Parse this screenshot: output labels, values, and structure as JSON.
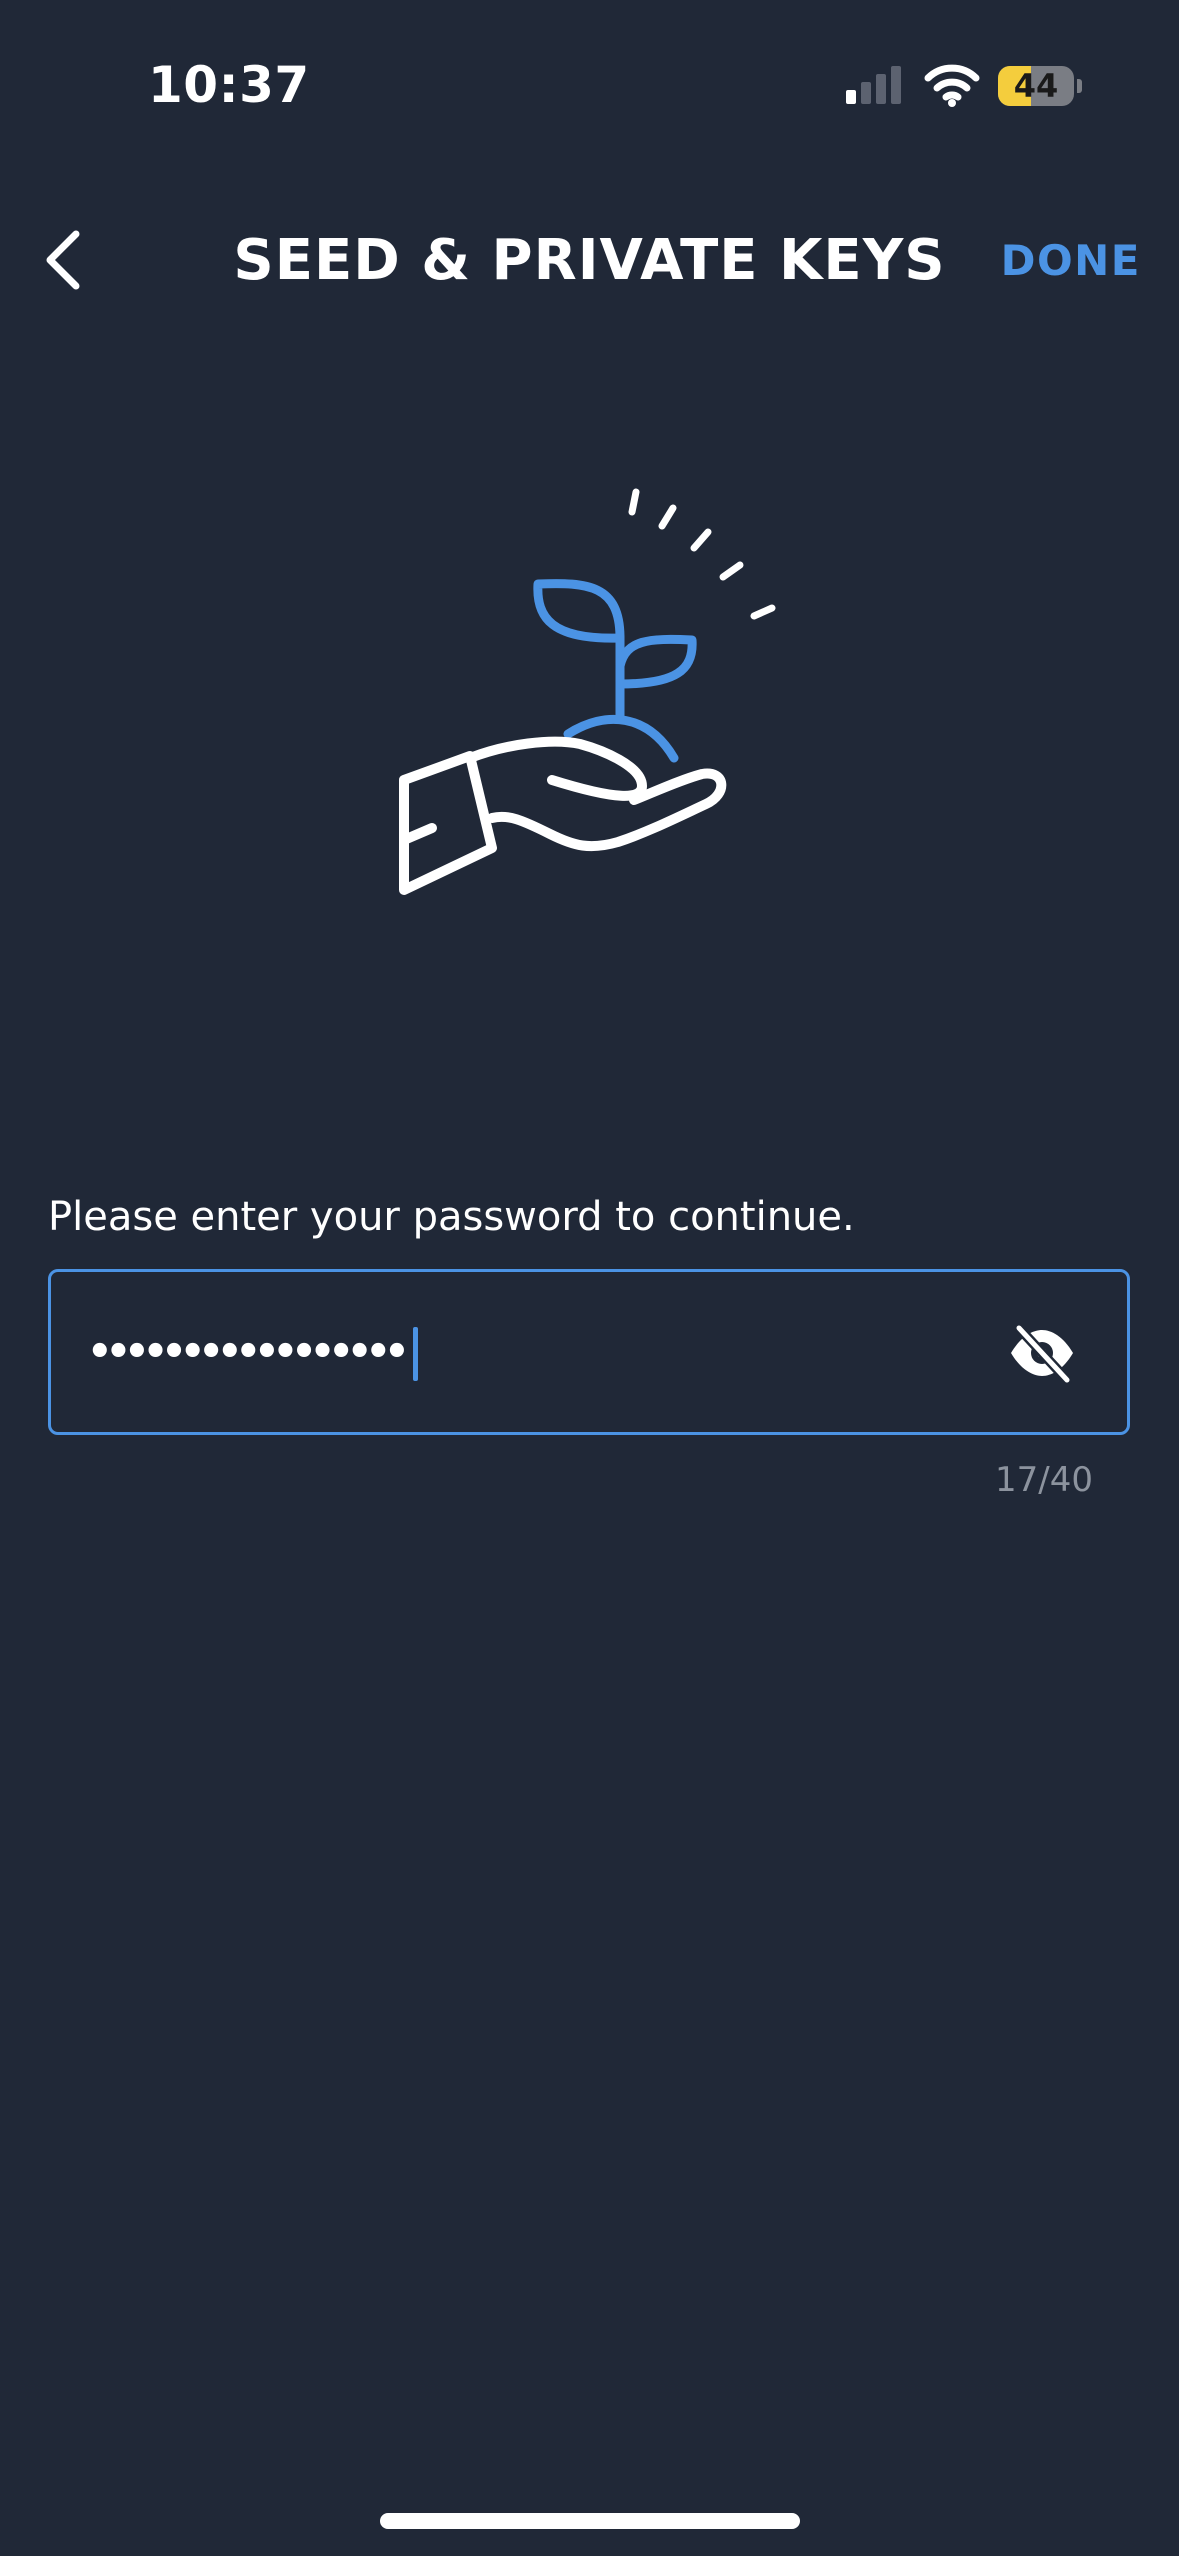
{
  "status_bar": {
    "time": "10:37",
    "battery_level": "44",
    "battery_fraction": 0.44
  },
  "nav": {
    "title": "SEED & PRIVATE KEYS",
    "done_label": "DONE",
    "back_icon": "chevron-left-icon"
  },
  "illustration": {
    "icon": "hand-holding-sprout-icon"
  },
  "form": {
    "prompt": "Please enter your password to continue.",
    "password_masked": "•••••••••••••••••",
    "visibility_icon": "eye-off-icon",
    "char_counter": "17/40"
  },
  "colors": {
    "background": "#202837",
    "accent": "#4b93e4",
    "battery": "#f4cd3d",
    "muted_text": "#8c939e"
  }
}
